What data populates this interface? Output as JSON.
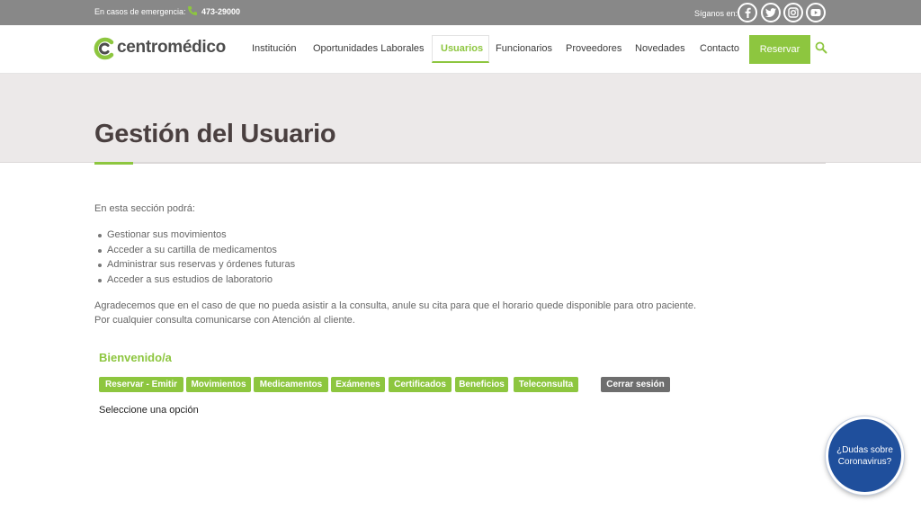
{
  "topbar": {
    "emergency_label": "En casos de emergencia:",
    "phone_icon": "phone-icon",
    "phone": "473-29000",
    "follow_label": "Síganos en:",
    "social": [
      "facebook-icon",
      "twitter-icon",
      "instagram-icon",
      "youtube-icon"
    ]
  },
  "header": {
    "logo_text": "centromédico",
    "nav": {
      "institucion": "Institución",
      "oportunidades": "Oportunidades Laborales",
      "usuarios": "Usuarios",
      "funcionarios": "Funcionarios",
      "proveedores": "Proveedores",
      "novedades": "Novedades",
      "contacto": "Contacto"
    },
    "reservar": "Reservar",
    "search_icon": "search-icon"
  },
  "page": {
    "title": "Gestión del Usuario",
    "intro": "En esta sección podrá:",
    "bullets": [
      "Gestionar sus movimientos",
      "Acceder a su cartilla de medicamentos",
      "Administrar sus reservas y órdenes futuras",
      "Acceder a sus estudios de laboratorio"
    ],
    "paragraph_line1": "Agradecemos que en el caso de que no pueda asistir a la consulta, anule su cita para que el horario quede disponible para otro paciente.",
    "paragraph_line2": "Por cualquier consulta comunicarse con Atención al cliente.",
    "welcome": "Bienvenido/a",
    "tabs": {
      "reservar": "Reservar - Emitir",
      "movimientos": "Movimientos",
      "medicamentos": "Medicamentos",
      "examenes": "Exámenes",
      "certificados": "Certificados",
      "beneficios": "Beneficios",
      "teleconsulta": "Teleconsulta"
    },
    "logout": "Cerrar sesión",
    "select_option": "Seleccione una opción"
  },
  "covid_badge": {
    "line1": "¿Dudas sobre",
    "line2": "Coronavirus?"
  },
  "colors": {
    "accent_green": "#8dc63f",
    "topbar_gray": "#888888",
    "hero_bg": "#ece9e9",
    "badge_blue": "#1f4f9c"
  }
}
